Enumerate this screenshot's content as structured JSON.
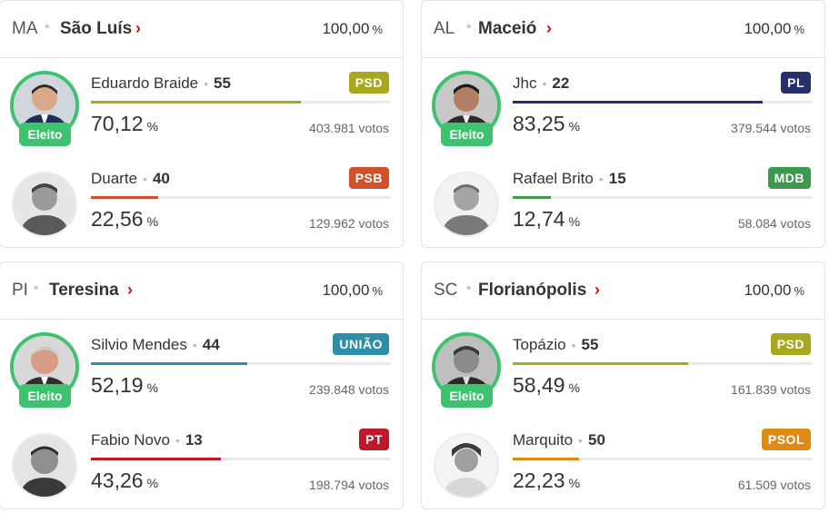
{
  "colors": {
    "elected_green": "#3fc26f",
    "link_red": "#c4170c",
    "border": "#e3e3e3"
  },
  "cards": [
    {
      "uf": "MA",
      "city": "São Luís",
      "apuradas": "100,00",
      "candidates": [
        {
          "name": "Eduardo Braide",
          "number": "55",
          "party": "PSD",
          "party_color": "#a8a81e",
          "pct": "70,12",
          "pct_value": 70.12,
          "votes": "403.981 votos",
          "elected": true,
          "elected_label": "Eleito",
          "avatar_icon": "candidate-photo"
        },
        {
          "name": "Duarte",
          "number": "40",
          "party": "PSB",
          "party_color": "#d2502a",
          "pct": "22,56",
          "pct_value": 22.56,
          "votes": "129.962 votos",
          "elected": false,
          "avatar_icon": "candidate-photo"
        }
      ]
    },
    {
      "uf": "AL",
      "city": "Maceió",
      "apuradas": "100,00",
      "candidates": [
        {
          "name": "Jhc",
          "number": "22",
          "party": "PL",
          "party_color": "#28306a",
          "pct": "83,25",
          "pct_value": 83.25,
          "votes": "379.544 votos",
          "elected": true,
          "elected_label": "Eleito",
          "avatar_icon": "candidate-photo"
        },
        {
          "name": "Rafael Brito",
          "number": "15",
          "party": "MDB",
          "party_color": "#3c9a4c",
          "pct": "12,74",
          "pct_value": 12.74,
          "votes": "58.084 votos",
          "elected": false,
          "avatar_icon": "candidate-photo"
        }
      ]
    },
    {
      "uf": "PI",
      "city": "Teresina",
      "apuradas": "100,00",
      "candidates": [
        {
          "name": "Silvio Mendes",
          "number": "44",
          "party": "UNIÃO",
          "party_color": "#2d8ea6",
          "pct": "52,19",
          "pct_value": 52.19,
          "votes": "239.848 votos",
          "elected": true,
          "elected_label": "Eleito",
          "avatar_icon": "candidate-photo"
        },
        {
          "name": "Fabio Novo",
          "number": "13",
          "party": "PT",
          "party_color": "#c0182a",
          "pct": "43,26",
          "pct_value": 43.26,
          "votes": "198.794 votos",
          "elected": false,
          "avatar_icon": "candidate-photo"
        }
      ]
    },
    {
      "uf": "SC",
      "city": "Florianópolis",
      "apuradas": "100,00",
      "candidates": [
        {
          "name": "Topázio",
          "number": "55",
          "party": "PSD",
          "party_color": "#a8a81e",
          "pct": "58,49",
          "pct_value": 58.49,
          "votes": "161.839 votos",
          "elected": true,
          "elected_label": "Eleito",
          "avatar_icon": "candidate-photo"
        },
        {
          "name": "Marquito",
          "number": "50",
          "party": "PSOL",
          "party_color": "#e08a16",
          "pct": "22,23",
          "pct_value": 22.23,
          "votes": "61.509 votos",
          "elected": false,
          "avatar_icon": "candidate-photo"
        }
      ]
    }
  ]
}
